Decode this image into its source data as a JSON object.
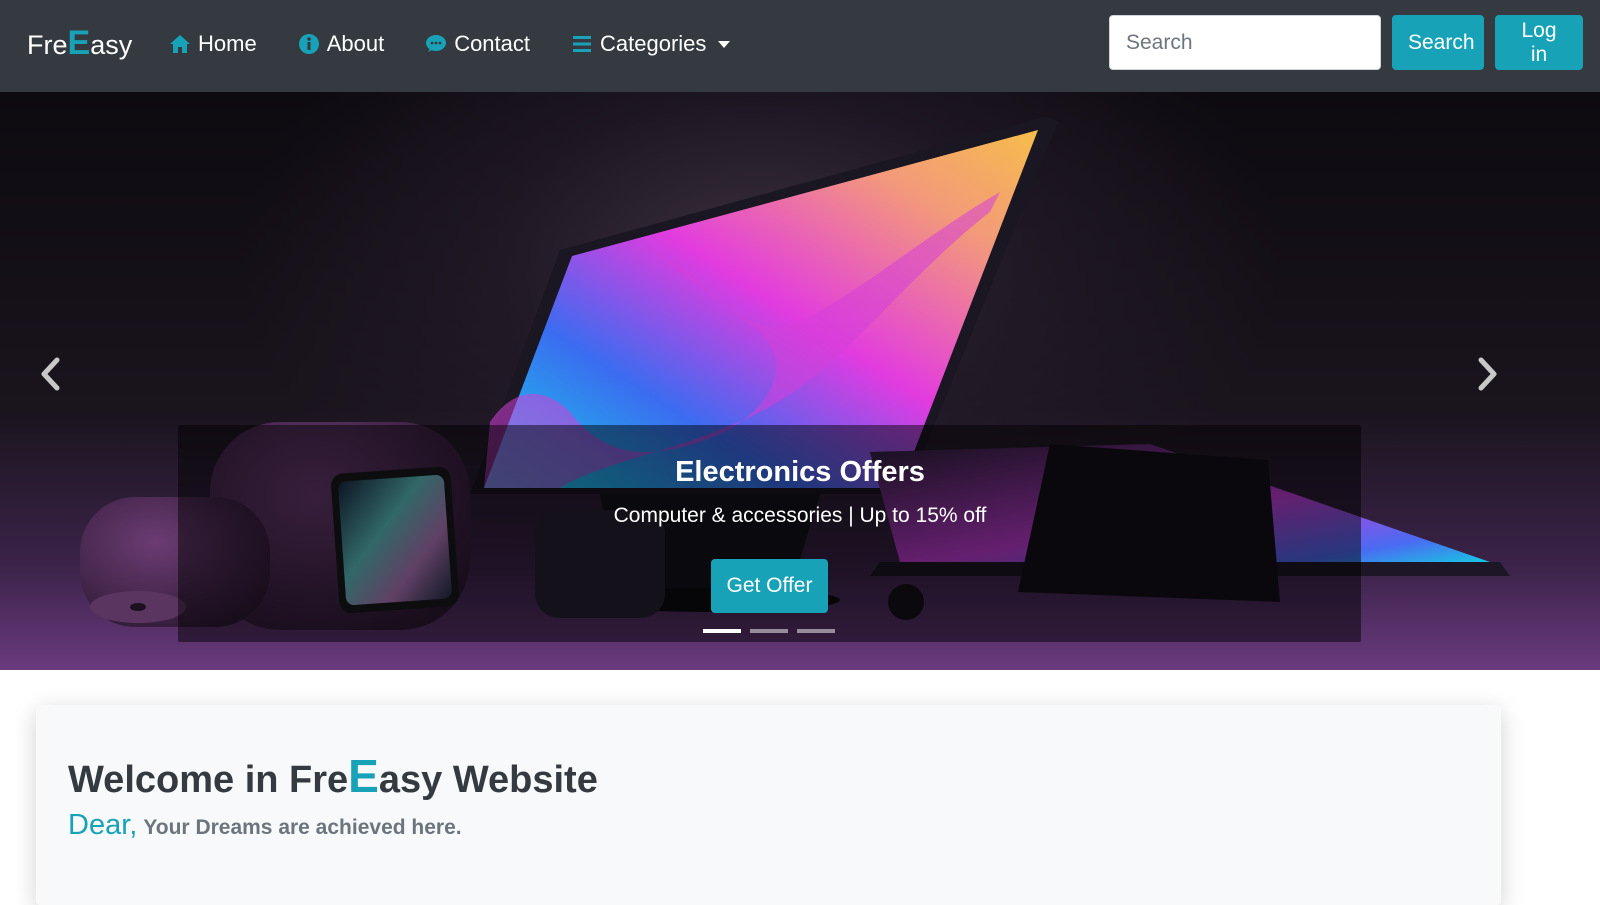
{
  "brand": {
    "prefix": "Fre",
    "highlight": "E",
    "suffix": "asy"
  },
  "nav": {
    "items": [
      {
        "label": "Home",
        "icon": "home-icon"
      },
      {
        "label": "About",
        "icon": "info-circle-icon"
      },
      {
        "label": "Contact",
        "icon": "comment-icon"
      },
      {
        "label": "Categories",
        "icon": "bars-icon"
      }
    ]
  },
  "search": {
    "placeholder": "Search",
    "button_label": "Search"
  },
  "login": {
    "label": "Log in"
  },
  "carousel": {
    "slide_title": "Electronics Offers",
    "slide_subtitle": "Computer & accessories | Up to 15% off",
    "button_label": "Get Offer",
    "active_index": 0,
    "slide_count": 3
  },
  "welcome": {
    "title_prefix": "Welcome in Fre",
    "title_highlight": "E",
    "title_suffix": "asy Website",
    "greeting": "Dear,",
    "tagline": "Your Dreams are achieved here."
  },
  "colors": {
    "navbar_bg": "#343a40",
    "accent": "#17a2b8",
    "jumbotron_bg": "#f8f9fa"
  }
}
